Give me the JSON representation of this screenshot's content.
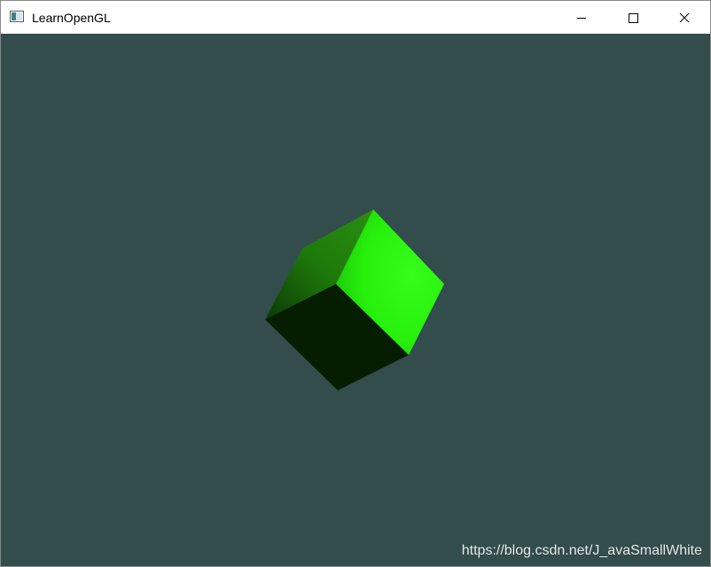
{
  "window": {
    "title": "LearnOpenGL",
    "icon": "app-window-icon",
    "controls": {
      "minimize_icon": "minimize-icon",
      "maximize_icon": "maximize-icon",
      "close_icon": "close-icon"
    }
  },
  "viewport": {
    "clear_color": "#334d4d",
    "object": "cube",
    "face_colors": {
      "lit_face": "#2cff0e",
      "top_face": "#1e7a0a",
      "shadow_face": "#051e02"
    }
  },
  "watermark": {
    "text": "https://blog.csdn.net/J_avaSmallWhite"
  }
}
